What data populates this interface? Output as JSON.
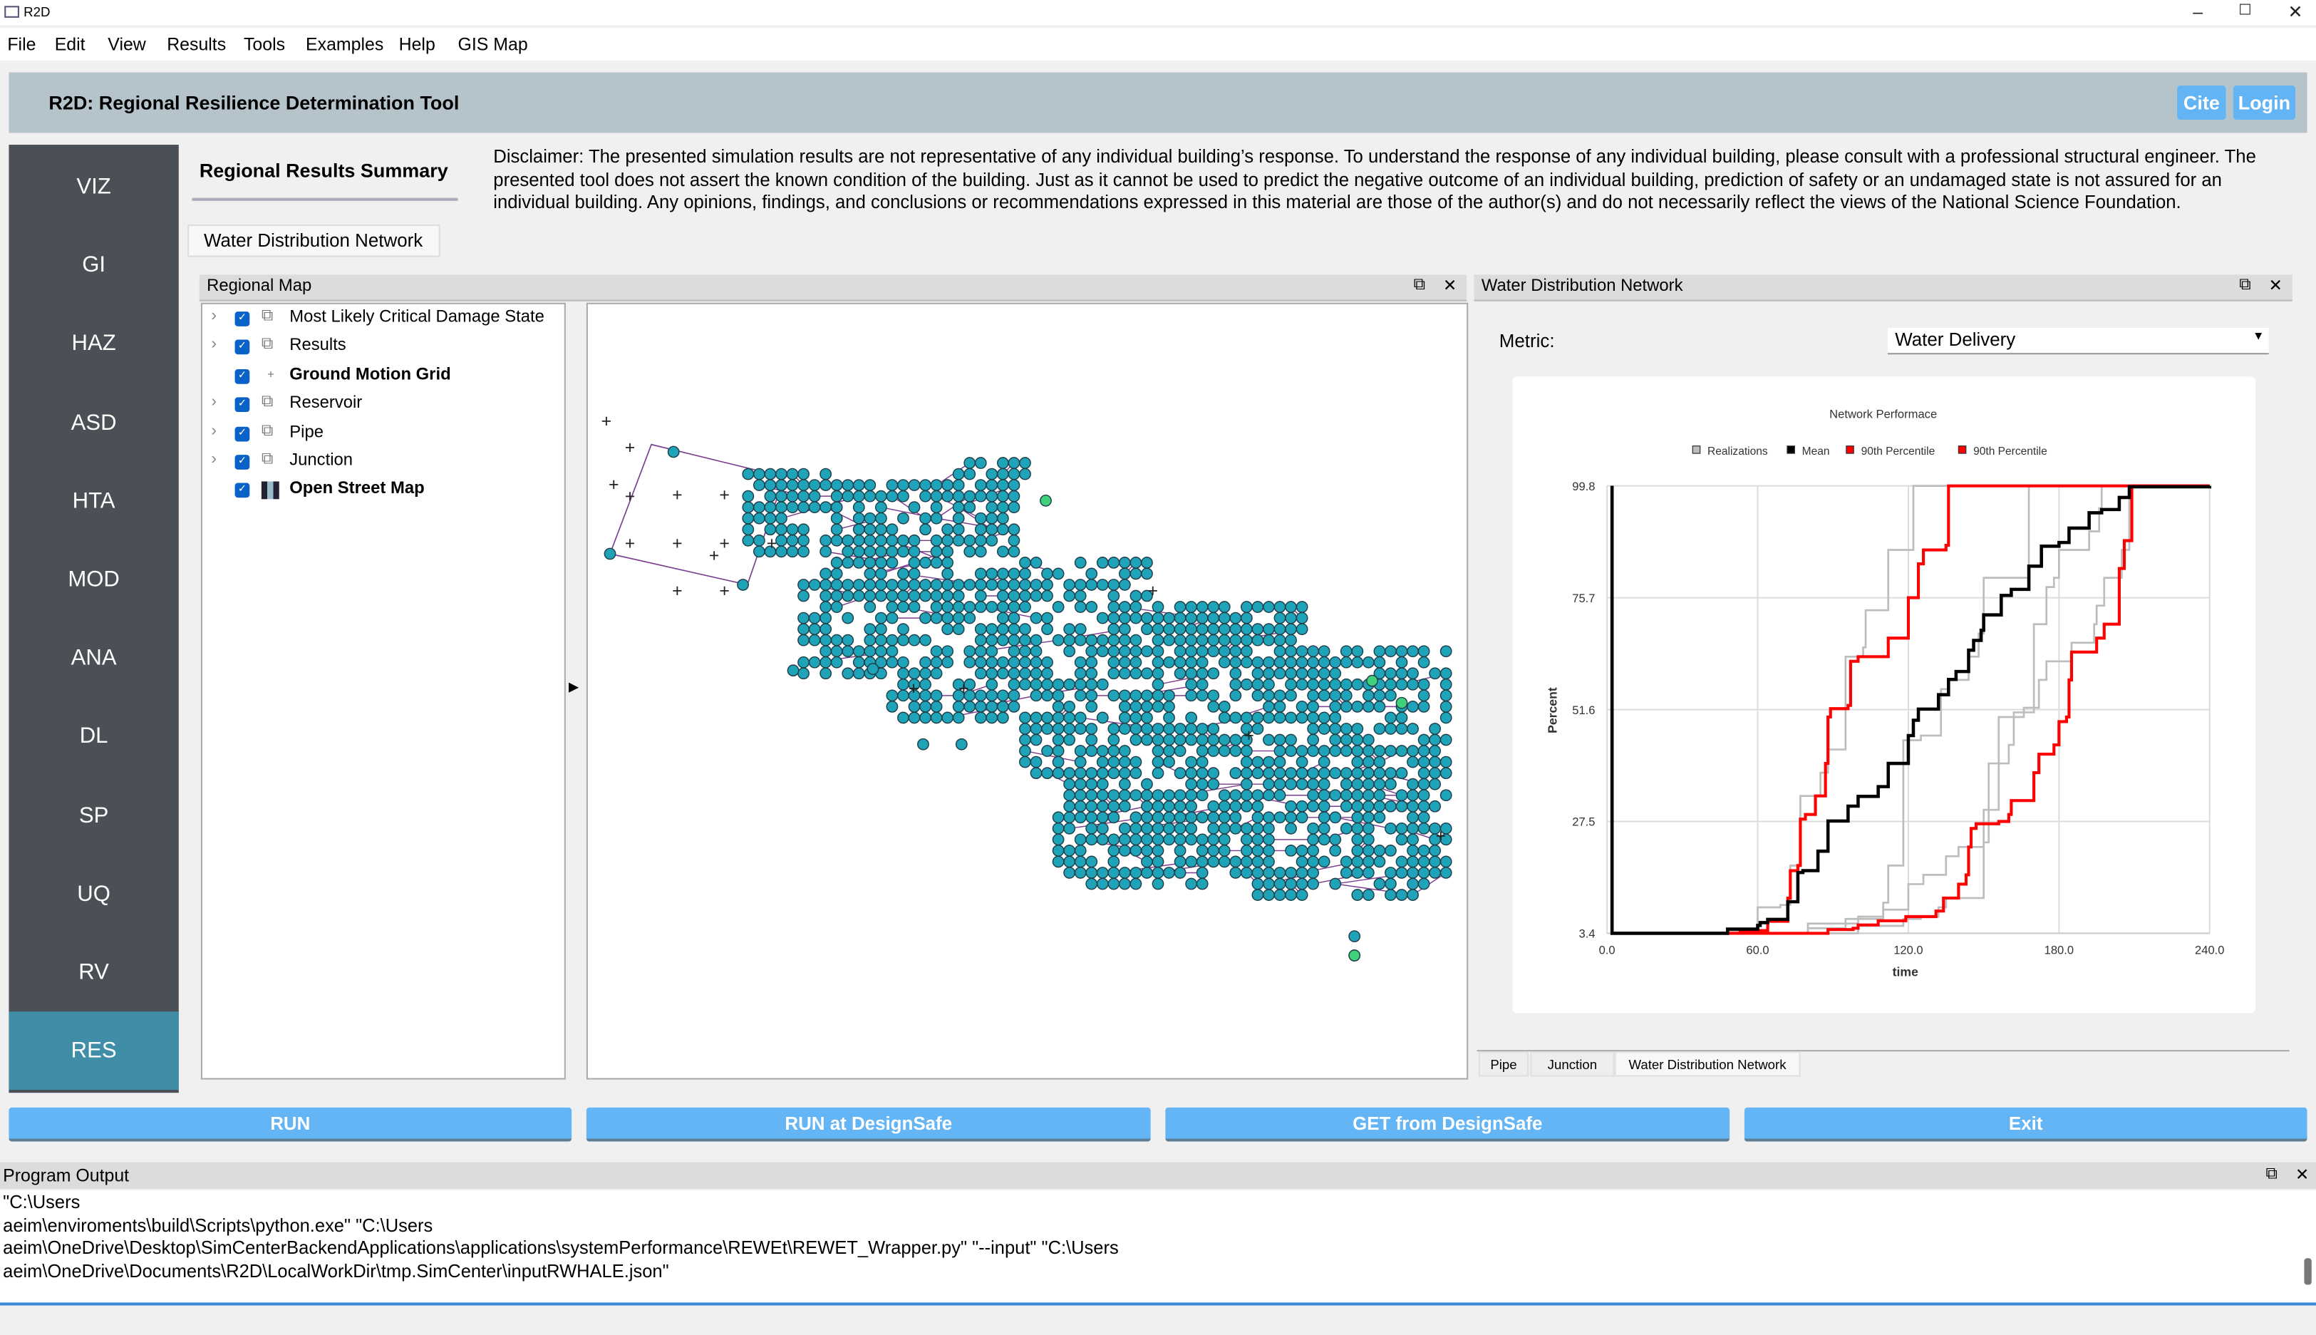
{
  "window": {
    "title": "R2D",
    "controls": [
      "minimize",
      "maximize",
      "close"
    ]
  },
  "menu": [
    "File",
    "Edit",
    "View",
    "Results",
    "Tools",
    "Examples",
    "Help",
    "GIS Map"
  ],
  "header": {
    "title": "R2D: Regional Resilience Determination Tool",
    "cite": "Cite",
    "login": "Login",
    "accent": "#63b4f5"
  },
  "sidebar": {
    "items": [
      "VIZ",
      "GI",
      "HAZ",
      "ASD",
      "HTA",
      "MOD",
      "ANA",
      "DL",
      "SP",
      "UQ",
      "RV",
      "RES"
    ],
    "selected": "RES",
    "selected_color": "#3f8da6"
  },
  "main": {
    "summary_tab": "Regional Results Summary",
    "disclaimer": "Disclaimer: The presented simulation results are not representative of any individual building’s response. To understand the response of any individual building, please consult with a professional structural engineer. The presented tool does not assert the known condition of the building. Just as it cannot be used to predict the negative outcome of an individual building, prediction of safety or an undamaged state is not assured for an individual building. Any opinions, findings, and conclusions or recommendations expressed in this material are those of the author(s) and do not necessarily reflect the views of the National Science Foundation.",
    "sub_tab": "Water Distribution Network"
  },
  "regional_map": {
    "title": "Regional Map",
    "layers": [
      {
        "label": "Most Likely Critical Damage State",
        "expandable": true,
        "checked": true,
        "bold": false,
        "icon": "layer-group-icon"
      },
      {
        "label": "Results",
        "expandable": true,
        "checked": true,
        "bold": false,
        "icon": "layer-group-icon"
      },
      {
        "label": "Ground Motion Grid",
        "expandable": false,
        "checked": true,
        "bold": true,
        "icon": "point-icon"
      },
      {
        "label": "Reservoir",
        "expandable": true,
        "checked": true,
        "bold": false,
        "icon": "layer-group-icon"
      },
      {
        "label": "Pipe",
        "expandable": true,
        "checked": true,
        "bold": false,
        "icon": "layer-group-icon"
      },
      {
        "label": "Junction",
        "expandable": true,
        "checked": true,
        "bold": false,
        "icon": "layer-group-icon"
      },
      {
        "label": "Open Street Map",
        "expandable": false,
        "checked": true,
        "bold": true,
        "icon": "tile-map-icon"
      }
    ],
    "colors": {
      "junction": "#1fa3b8",
      "pipe": "#7b3d8f",
      "reservoir": "#3fd27a"
    }
  },
  "wdn_panel": {
    "title": "Water Distribution Network",
    "metric_label": "Metric:",
    "metric_value": "Water Delivery",
    "tabs": [
      "Pipe",
      "Junction",
      "Water Distribution Network"
    ],
    "selected_tab": "Water Distribution Network"
  },
  "chart_data": {
    "type": "line",
    "title": "Network Performace",
    "xlabel": "time",
    "ylabel": "Percent",
    "xlim": [
      0,
      240
    ],
    "ylim": [
      3.4,
      99.8
    ],
    "xticks": [
      "0.0",
      "60.0",
      "120.0",
      "180.0",
      "240.0"
    ],
    "yticks": [
      "3.4",
      "27.5",
      "51.6",
      "75.7",
      "99.8"
    ],
    "grid": true,
    "legend": "top",
    "step": true,
    "legend_entries": [
      {
        "name": "Realizations",
        "color": "#bdbdbd"
      },
      {
        "name": "Mean",
        "color": "#000000"
      },
      {
        "name": "90th Percentile",
        "color": "#ff0000"
      },
      {
        "name": "90th Percentile",
        "color": "#ff0000"
      }
    ],
    "realizations": [
      [
        [
          2,
          99.8
        ],
        [
          2,
          3.4
        ],
        [
          48,
          4
        ],
        [
          60,
          9
        ],
        [
          69,
          9.5
        ],
        [
          73,
          18
        ],
        [
          77,
          33
        ],
        [
          83,
          33
        ],
        [
          85,
          38
        ],
        [
          88,
          43
        ],
        [
          95,
          63
        ],
        [
          102,
          65
        ],
        [
          103,
          73
        ],
        [
          112,
          74
        ],
        [
          112,
          86
        ],
        [
          121,
          86
        ],
        [
          122,
          99.8
        ],
        [
          240,
          99.8
        ]
      ],
      [
        [
          2,
          3.4
        ],
        [
          70,
          3.4
        ],
        [
          80,
          4.5
        ],
        [
          95,
          6.5
        ],
        [
          110,
          8.5
        ],
        [
          120,
          14
        ],
        [
          126,
          16
        ],
        [
          135,
          20
        ],
        [
          140,
          22
        ],
        [
          150,
          23
        ],
        [
          152,
          40
        ],
        [
          160,
          44
        ],
        [
          162,
          51
        ],
        [
          170,
          62
        ],
        [
          170,
          70
        ],
        [
          175,
          78
        ],
        [
          178,
          80
        ],
        [
          180,
          86
        ],
        [
          192,
          90
        ],
        [
          196,
          95
        ],
        [
          197,
          99.8
        ],
        [
          240,
          99.8
        ]
      ],
      [
        [
          2,
          3.4
        ],
        [
          60,
          3.4
        ],
        [
          80,
          5.5
        ],
        [
          100,
          7
        ],
        [
          110,
          10
        ],
        [
          112,
          18
        ],
        [
          118,
          19
        ],
        [
          118,
          45
        ],
        [
          125,
          46
        ],
        [
          133,
          56
        ],
        [
          136,
          58
        ],
        [
          144,
          63
        ],
        [
          148,
          68
        ],
        [
          150,
          80
        ],
        [
          168,
          80
        ],
        [
          168,
          99.8
        ],
        [
          240,
          99.8
        ]
      ],
      [
        [
          2,
          3.4
        ],
        [
          85,
          3.4
        ],
        [
          100,
          5
        ],
        [
          118,
          6.5
        ],
        [
          125,
          7
        ],
        [
          132,
          9
        ],
        [
          135,
          11
        ],
        [
          150,
          14
        ],
        [
          150,
          30
        ],
        [
          156,
          30
        ],
        [
          156,
          50
        ],
        [
          166,
          52
        ],
        [
          172,
          58
        ],
        [
          175,
          62
        ],
        [
          185,
          66
        ],
        [
          194,
          70
        ],
        [
          195,
          74
        ],
        [
          198,
          80
        ],
        [
          205,
          86
        ],
        [
          208,
          99.8
        ],
        [
          240,
          99.8
        ]
      ]
    ],
    "mean": [
      [
        2,
        99.8
      ],
      [
        2,
        3.4
      ],
      [
        39,
        3.4
      ],
      [
        48,
        4.3
      ],
      [
        60,
        5.1
      ],
      [
        61,
        5.7
      ],
      [
        64,
        6.4
      ],
      [
        72,
        10.2
      ],
      [
        76,
        16.5
      ],
      [
        78,
        16.9
      ],
      [
        84,
        21.1
      ],
      [
        88,
        27.6
      ],
      [
        96,
        30.8
      ],
      [
        100,
        32.9
      ],
      [
        108,
        35
      ],
      [
        112,
        40
      ],
      [
        120,
        46
      ],
      [
        122,
        49.3
      ],
      [
        124,
        51.7
      ],
      [
        132,
        54.8
      ],
      [
        136,
        58.1
      ],
      [
        139,
        59.8
      ],
      [
        144,
        64.4
      ],
      [
        146,
        66.5
      ],
      [
        149,
        68.7
      ],
      [
        150,
        72
      ],
      [
        157,
        76.2
      ],
      [
        161,
        77.5
      ],
      [
        168,
        82.5
      ],
      [
        173,
        86.8
      ],
      [
        180,
        87.6
      ],
      [
        184,
        90.7
      ],
      [
        192,
        94
      ],
      [
        197,
        94.7
      ],
      [
        204,
        97.3
      ],
      [
        208,
        99.6
      ],
      [
        240,
        99.8
      ]
    ],
    "percentile_upper": [
      [
        2,
        99.8
      ],
      [
        2,
        3.4
      ],
      [
        50,
        3.4
      ],
      [
        53,
        4
      ],
      [
        64,
        6
      ],
      [
        72,
        11
      ],
      [
        73,
        16.9
      ],
      [
        76,
        18
      ],
      [
        77,
        28
      ],
      [
        79,
        29
      ],
      [
        83,
        33
      ],
      [
        87,
        40
      ],
      [
        88,
        50
      ],
      [
        89,
        51.8
      ],
      [
        96,
        52.5
      ],
      [
        97,
        62
      ],
      [
        100,
        63
      ],
      [
        108,
        63
      ],
      [
        112,
        67
      ],
      [
        120,
        75.7
      ],
      [
        124,
        83
      ],
      [
        126,
        86
      ],
      [
        135,
        87
      ],
      [
        136,
        99.8
      ],
      [
        240,
        99.8
      ]
    ],
    "percentile_lower": [
      [
        2,
        99.8
      ],
      [
        2,
        3.4
      ],
      [
        82,
        3.4
      ],
      [
        88,
        4.2
      ],
      [
        98,
        4.5
      ],
      [
        100,
        5.2
      ],
      [
        108,
        6.1
      ],
      [
        119,
        7
      ],
      [
        131,
        8.2
      ],
      [
        134,
        11
      ],
      [
        140,
        14
      ],
      [
        143,
        16
      ],
      [
        144,
        22
      ],
      [
        145,
        26
      ],
      [
        147,
        27
      ],
      [
        156,
        27.5
      ],
      [
        160,
        29
      ],
      [
        161,
        32
      ],
      [
        168,
        32
      ],
      [
        170,
        38
      ],
      [
        172,
        42
      ],
      [
        178,
        44
      ],
      [
        180,
        49
      ],
      [
        183,
        50
      ],
      [
        184,
        58
      ],
      [
        185,
        64
      ],
      [
        194,
        64
      ],
      [
        195,
        67
      ],
      [
        198,
        70
      ],
      [
        204,
        71
      ],
      [
        204,
        82
      ],
      [
        206,
        88
      ],
      [
        208,
        88
      ],
      [
        209,
        99.8
      ],
      [
        240,
        99.8
      ]
    ]
  },
  "buttons": {
    "run": "RUN",
    "run_ds": "RUN at DesignSafe",
    "get_ds": "GET from DesignSafe",
    "exit": "Exit",
    "color": "#64b5f6"
  },
  "output": {
    "title": "Program Output",
    "lines": [
      "\"C:\\Users",
      "aeim\\enviroments\\build\\Scripts\\python.exe\" \"C:\\Users",
      "aeim\\OneDrive\\Desktop\\SimCenterBackendApplications\\applications\\systemPerformance\\REWEt\\REWET_Wrapper.py\" \"--input\" \"C:\\Users",
      "aeim\\OneDrive\\Documents\\R2D\\LocalWorkDir\\tmp.SimCenter\\inputRWHALE.json\""
    ]
  }
}
